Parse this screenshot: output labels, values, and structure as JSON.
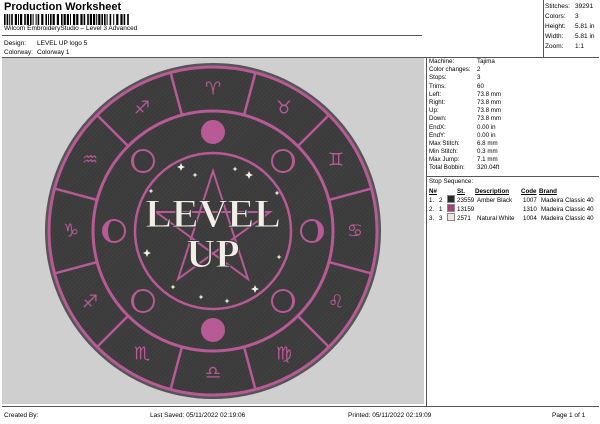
{
  "header": {
    "title": "Production Worksheet",
    "software": "Wilcom EmbroideryStudio – Level 3 Advanced",
    "design_label": "Design:",
    "design_value": "LEVEL UP logo 5",
    "colorway_label": "Colorway:",
    "colorway_value": "Colorway 1"
  },
  "stats": [
    {
      "k": "Stitches:",
      "v": "39291"
    },
    {
      "k": "Colors:",
      "v": "3"
    },
    {
      "k": "Height:",
      "v": "5.81 in"
    },
    {
      "k": "Width:",
      "v": "5.81 in"
    },
    {
      "k": "Zoom:",
      "v": "1:1"
    }
  ],
  "machine_info": [
    {
      "k": "Machine:",
      "v": "Tajima"
    },
    {
      "k": "Color changes:",
      "v": "2"
    },
    {
      "k": "Stops:",
      "v": "3"
    },
    {
      "k": "Trims:",
      "v": "60"
    },
    {
      "k": "Left:",
      "v": "73.8 mm"
    },
    {
      "k": "Right:",
      "v": "73.8 mm"
    },
    {
      "k": "Up:",
      "v": "73.8 mm"
    },
    {
      "k": "Down:",
      "v": "73.8 mm"
    },
    {
      "k": "EndX:",
      "v": "0.00 in"
    },
    {
      "k": "EndY:",
      "v": "0.00 in"
    },
    {
      "k": "Max Stitch:",
      "v": "6.8 mm"
    },
    {
      "k": "Min Stitch:",
      "v": "0.3 mm"
    },
    {
      "k": "Max Jump:",
      "v": "7.1 mm"
    },
    {
      "k": "Total Bobbin:",
      "v": "320.04ft"
    }
  ],
  "stop_sequence": {
    "title": "Stop Sequence:",
    "headers": [
      "N#",
      "St.",
      "Description",
      "Code",
      "Brand"
    ],
    "rows": [
      {
        "order": "1.",
        "num": "2",
        "color": "#2a2a2a",
        "st": "23559",
        "desc": "Amber Black",
        "code": "1007",
        "brand": "Madeira Classic 40"
      },
      {
        "order": "2.",
        "num": "1",
        "color": "#a3437a",
        "st": "13159",
        "desc": "",
        "code": "1310",
        "brand": "Madeira Classic 40"
      },
      {
        "order": "3.",
        "num": "3",
        "color": "#ece8df",
        "st": "2571",
        "desc": "Natural White",
        "code": "1004",
        "brand": "Madeira Classic 40"
      }
    ]
  },
  "design": {
    "text_line1": "LEVEL",
    "text_line2": "UP",
    "zodiac": [
      "♐",
      "♈",
      "♉",
      "♊",
      "♋",
      "♌",
      "♍",
      "♎",
      "♏",
      "♐",
      "♑",
      "♒"
    ],
    "colors": {
      "black": "#3b3b3b",
      "pink": "#b85a96",
      "white": "#f1eee6",
      "bg": "#cfcfcf"
    }
  },
  "footer": {
    "created_by": "Created By:",
    "last_saved": "Last Saved: 05/11/2022 02:19:06",
    "printed": "Printed: 05/11/2022 02:19:09",
    "page": "Page 1 of 1"
  }
}
